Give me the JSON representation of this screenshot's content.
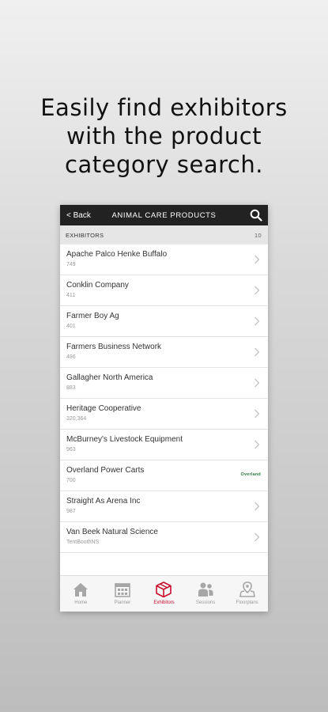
{
  "headline": {
    "line1": "Easily find exhibitors",
    "line2": "with the product",
    "line3": "category search."
  },
  "topbar": {
    "back_label": "< Back",
    "title": "ANIMAL CARE PRODUCTS",
    "search_icon": "search-icon"
  },
  "section": {
    "label": "EXHIBITORS",
    "count": "10"
  },
  "exhibitors": [
    {
      "name": "Apache Palco Henke Buffalo",
      "booth": "749"
    },
    {
      "name": "Conklin Company",
      "booth": "411"
    },
    {
      "name": "Farmer Boy Ag",
      "booth": "401"
    },
    {
      "name": "Farmers Business Network",
      "booth": "486"
    },
    {
      "name": "Gallagher North America",
      "booth": "883"
    },
    {
      "name": "Heritage Cooperative",
      "booth": "320,364"
    },
    {
      "name": "McBurney's Livestock Equipment",
      "booth": "963"
    },
    {
      "name": "Overland Power Carts",
      "booth": "700",
      "logo": "Overland"
    },
    {
      "name": "Straight As Arena Inc",
      "booth": "987"
    },
    {
      "name": "Van Beek Natural Science",
      "booth": "TentBoothNS"
    }
  ],
  "tabs": [
    {
      "label": "Home",
      "icon": "home-icon"
    },
    {
      "label": "Planner",
      "icon": "calendar-icon"
    },
    {
      "label": "Exhibitors",
      "icon": "box-icon",
      "active": true
    },
    {
      "label": "Sessions",
      "icon": "people-icon"
    },
    {
      "label": "Floorplans",
      "icon": "map-pin-icon"
    }
  ],
  "colors": {
    "topbar": "#222222",
    "accent": "#c8102e",
    "logo_green": "#2d7a3e"
  }
}
